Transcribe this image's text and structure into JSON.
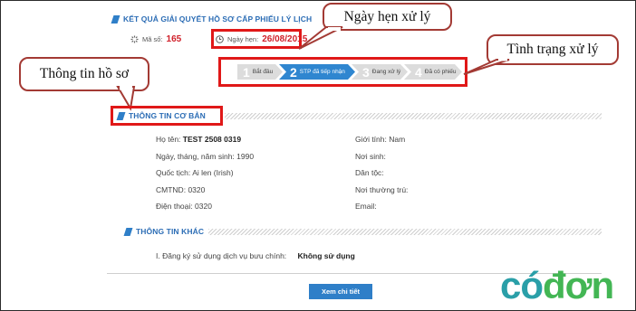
{
  "header": {
    "title": "KẾT QUẢ GIẢI QUYẾT HỒ SƠ CẤP PHIẾU LÝ LỊCH"
  },
  "record": {
    "ma_so_label": "Mã số:",
    "ma_so_value": "165",
    "ngay_hen_label": "Ngày hẹn:",
    "ngay_hen_value": "26/08/2015"
  },
  "steps": [
    {
      "num": "1",
      "label": "Bắt đầu",
      "state": "done"
    },
    {
      "num": "2",
      "label": "STP đã tiếp nhận",
      "state": "active"
    },
    {
      "num": "3",
      "label": "Đang xử lý",
      "state": "pending"
    },
    {
      "num": "4",
      "label": "Đã có phiếu",
      "state": "pending"
    }
  ],
  "callouts": {
    "ngay_hen": "Ngày hẹn xử lý",
    "tinh_trang": "Tình trạng xử lý",
    "thong_tin": "Thông tin hồ sơ"
  },
  "basic": {
    "title": "THÔNG TIN CƠ BẢN",
    "left": [
      {
        "label": "Họ tên:",
        "value": "TEST 2508 0319"
      },
      {
        "label": "Ngày, tháng, năm sinh:",
        "value": "1990"
      },
      {
        "label": "Quốc tịch:",
        "value": "Ai len (Irish)"
      },
      {
        "label": "CMTND:",
        "value": "0320"
      },
      {
        "label": "Điện thoại:",
        "value": "0320"
      }
    ],
    "right": [
      {
        "label": "Giới tính:",
        "value": "Nam"
      },
      {
        "label": "Nơi sinh:",
        "value": ""
      },
      {
        "label": "Dân tộc:",
        "value": ""
      },
      {
        "label": "Nơi thường trú:",
        "value": ""
      },
      {
        "label": "Email:",
        "value": ""
      }
    ]
  },
  "other": {
    "title": "THÔNG TIN KHÁC",
    "item_label": "I. Đăng ký sử dụng dịch vụ bưu chính:",
    "item_value": "Không sử dụng"
  },
  "actions": {
    "detail_button": "Xem chi tiết"
  },
  "logo": {
    "part1": "có",
    "part2": "đơn"
  }
}
